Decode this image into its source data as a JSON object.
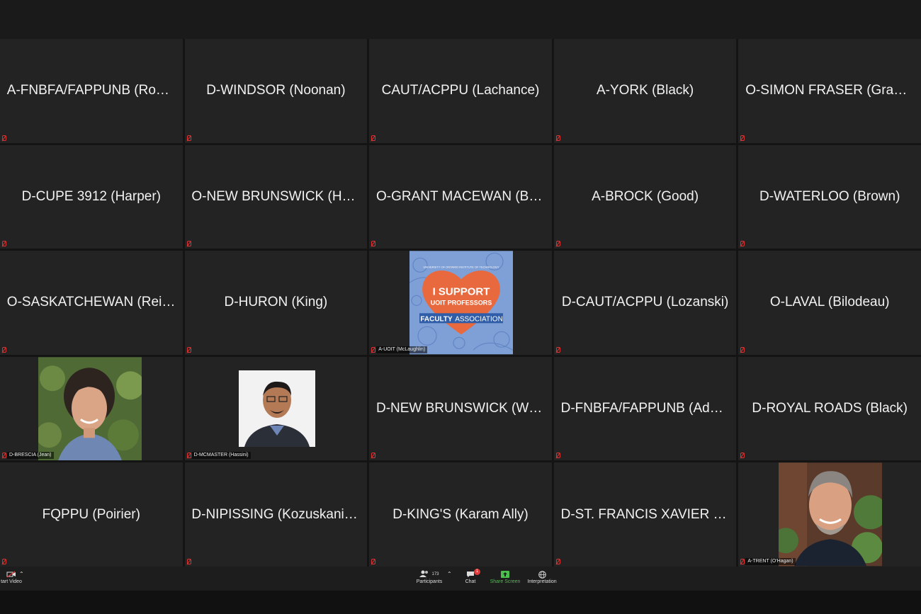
{
  "tiles": [
    {
      "name": "A-FNBFA/FAPPUNB (Robic..."
    },
    {
      "name": "D-WINDSOR (Noonan)"
    },
    {
      "name": "CAUT/ACPPU (Lachance)"
    },
    {
      "name": "A-YORK (Black)"
    },
    {
      "name": "O-SIMON FRASER (Graebn..."
    },
    {
      "name": "D-CUPE 3912 (Harper)"
    },
    {
      "name": "O-NEW BRUNSWICK (Horn..."
    },
    {
      "name": "O-GRANT MACEWAN (Bak..."
    },
    {
      "name": "A-BROCK (Good)"
    },
    {
      "name": "D-WATERLOO  (Brown)"
    },
    {
      "name": "O-SASKATCHEWAN (Reich)"
    },
    {
      "name": "D-HURON (King)"
    },
    {
      "name": "A-UOIT (McLaughlin)"
    },
    {
      "name": "D-CAUT/ACPPU (Lozanski)"
    },
    {
      "name": "O-LAVAL (Bilodeau)"
    },
    {
      "name": "D-BRESCIA (Jean)"
    },
    {
      "name": "D-MCMASTER (Hassini)"
    },
    {
      "name": "D-NEW BRUNSWICK (White)"
    },
    {
      "name": "D-FNBFA/FAPPUNB (Adeg..."
    },
    {
      "name": "D-ROYAL ROADS (Black)"
    },
    {
      "name": "FQPPU (Poirier)"
    },
    {
      "name": "D-NIPISSING (Kozuskanich)"
    },
    {
      "name": "D-KING'S (Karam Ally)"
    },
    {
      "name": "D-ST. FRANCIS XAVIER (va..."
    },
    {
      "name": "A-TRENT (O'Hagan)"
    }
  ],
  "poster": {
    "header": "UNIVERSITY OF ONTARIO INSTITUTE OF TECHNOLOGY",
    "line1": "I SUPPORT",
    "line2": "UOIT PROFESSORS",
    "line3a": "FACULTY",
    "line3b": "ASSOCIATION"
  },
  "toolbar": {
    "start_video": "tart Video",
    "participants_label": "Participants",
    "participants_count": "173",
    "chat_label": "Chat",
    "chat_badge": "1",
    "share_label": "Share Screen",
    "interpretation_label": "Interpretation"
  },
  "colors": {
    "share_green": "#4bbf4b",
    "mute_red": "#dd3333",
    "poster_blue": "#7fa0d6",
    "poster_heart": "#e8693d"
  },
  "icons": [
    "video-off-icon",
    "chevron-up-icon",
    "participants-icon",
    "chat-icon",
    "share-screen-icon",
    "globe-icon",
    "microphone-muted-icon"
  ]
}
